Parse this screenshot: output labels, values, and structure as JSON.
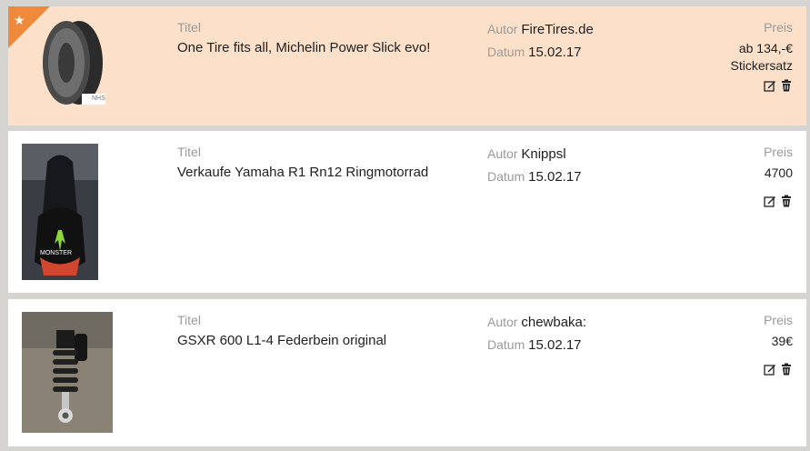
{
  "listings": [
    {
      "featured": true,
      "title_label": "Titel",
      "title": "One Tire fits all, Michelin Power Slick evo!",
      "author_label": "Autor",
      "author": "FireTires.de",
      "date_label": "Datum",
      "date": "15.02.17",
      "price_label": "Preis",
      "price_line1": "ab 134,-€",
      "price_line2": "Stickersatz",
      "image": "motorcycle-tire",
      "image_logo_text": "NHS"
    },
    {
      "featured": false,
      "title_label": "Titel",
      "title": "Verkaufe Yamaha R1 Rn12 Ringmotorrad",
      "author_label": "Autor",
      "author": "Knippsl",
      "date_label": "Datum",
      "date": "15.02.17",
      "price_label": "Preis",
      "price_line1": "4700",
      "image": "yamaha-r1-monster-energy",
      "image_text": "MONSTER"
    },
    {
      "featured": false,
      "title_label": "Titel",
      "title": "GSXR 600 L1-4 Federbein original",
      "author_label": "Autor",
      "author": "chewbaka:",
      "date_label": "Datum",
      "date": "15.02.17",
      "price_label": "Preis",
      "price_line1": "39€",
      "image": "shock-absorber"
    }
  ],
  "icons": {
    "badge": "star-icon",
    "edit": "edit-icon",
    "delete": "trash-icon"
  },
  "colors": {
    "featured_bg": "#fde0c9",
    "badge": "#ef8a3c",
    "label": "#9a9a9a",
    "text": "#1f1f1f"
  }
}
